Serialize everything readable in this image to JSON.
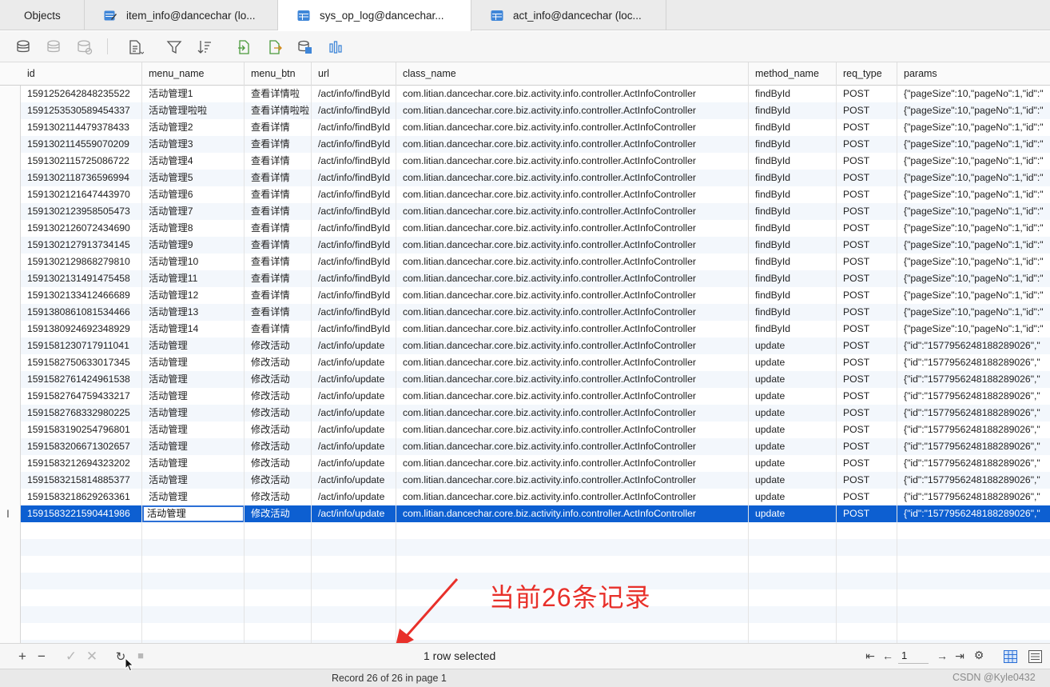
{
  "tabs": {
    "objects": "Objects",
    "t1": "item_info@dancechar (lo...",
    "t2": "sys_op_log@dancechar...",
    "t3": "act_info@dancechar (loc..."
  },
  "columns": [
    "id",
    "menu_name",
    "menu_btn",
    "url",
    "class_name",
    "method_name",
    "req_type",
    "params"
  ],
  "rows": [
    [
      "1591252642848235522",
      "活动管理1",
      "查看详情啦",
      "/act/info/findById",
      "com.litian.dancechar.core.biz.activity.info.controller.ActInfoController",
      "findById",
      "POST",
      "{\"pageSize\":10,\"pageNo\":1,\"id\":\""
    ],
    [
      "1591253530589454337",
      "活动管理啦啦",
      "查看详情啦啦",
      "/act/info/findById",
      "com.litian.dancechar.core.biz.activity.info.controller.ActInfoController",
      "findById",
      "POST",
      "{\"pageSize\":10,\"pageNo\":1,\"id\":\""
    ],
    [
      "1591302114479378433",
      "活动管理2",
      "查看详情",
      "/act/info/findById",
      "com.litian.dancechar.core.biz.activity.info.controller.ActInfoController",
      "findById",
      "POST",
      "{\"pageSize\":10,\"pageNo\":1,\"id\":\""
    ],
    [
      "1591302114559070209",
      "活动管理3",
      "查看详情",
      "/act/info/findById",
      "com.litian.dancechar.core.biz.activity.info.controller.ActInfoController",
      "findById",
      "POST",
      "{\"pageSize\":10,\"pageNo\":1,\"id\":\""
    ],
    [
      "1591302115725086722",
      "活动管理4",
      "查看详情",
      "/act/info/findById",
      "com.litian.dancechar.core.biz.activity.info.controller.ActInfoController",
      "findById",
      "POST",
      "{\"pageSize\":10,\"pageNo\":1,\"id\":\""
    ],
    [
      "1591302118736596994",
      "活动管理5",
      "查看详情",
      "/act/info/findById",
      "com.litian.dancechar.core.biz.activity.info.controller.ActInfoController",
      "findById",
      "POST",
      "{\"pageSize\":10,\"pageNo\":1,\"id\":\""
    ],
    [
      "1591302121647443970",
      "活动管理6",
      "查看详情",
      "/act/info/findById",
      "com.litian.dancechar.core.biz.activity.info.controller.ActInfoController",
      "findById",
      "POST",
      "{\"pageSize\":10,\"pageNo\":1,\"id\":\""
    ],
    [
      "1591302123958505473",
      "活动管理7",
      "查看详情",
      "/act/info/findById",
      "com.litian.dancechar.core.biz.activity.info.controller.ActInfoController",
      "findById",
      "POST",
      "{\"pageSize\":10,\"pageNo\":1,\"id\":\""
    ],
    [
      "1591302126072434690",
      "活动管理8",
      "查看详情",
      "/act/info/findById",
      "com.litian.dancechar.core.biz.activity.info.controller.ActInfoController",
      "findById",
      "POST",
      "{\"pageSize\":10,\"pageNo\":1,\"id\":\""
    ],
    [
      "1591302127913734145",
      "活动管理9",
      "查看详情",
      "/act/info/findById",
      "com.litian.dancechar.core.biz.activity.info.controller.ActInfoController",
      "findById",
      "POST",
      "{\"pageSize\":10,\"pageNo\":1,\"id\":\""
    ],
    [
      "1591302129868279810",
      "活动管理10",
      "查看详情",
      "/act/info/findById",
      "com.litian.dancechar.core.biz.activity.info.controller.ActInfoController",
      "findById",
      "POST",
      "{\"pageSize\":10,\"pageNo\":1,\"id\":\""
    ],
    [
      "1591302131491475458",
      "活动管理11",
      "查看详情",
      "/act/info/findById",
      "com.litian.dancechar.core.biz.activity.info.controller.ActInfoController",
      "findById",
      "POST",
      "{\"pageSize\":10,\"pageNo\":1,\"id\":\""
    ],
    [
      "1591302133412466689",
      "活动管理12",
      "查看详情",
      "/act/info/findById",
      "com.litian.dancechar.core.biz.activity.info.controller.ActInfoController",
      "findById",
      "POST",
      "{\"pageSize\":10,\"pageNo\":1,\"id\":\""
    ],
    [
      "1591380861081534466",
      "活动管理13",
      "查看详情",
      "/act/info/findById",
      "com.litian.dancechar.core.biz.activity.info.controller.ActInfoController",
      "findById",
      "POST",
      "{\"pageSize\":10,\"pageNo\":1,\"id\":\""
    ],
    [
      "1591380924692348929",
      "活动管理14",
      "查看详情",
      "/act/info/findById",
      "com.litian.dancechar.core.biz.activity.info.controller.ActInfoController",
      "findById",
      "POST",
      "{\"pageSize\":10,\"pageNo\":1,\"id\":\""
    ],
    [
      "1591581230717911041",
      "活动管理",
      "修改活动",
      "/act/info/update",
      "com.litian.dancechar.core.biz.activity.info.controller.ActInfoController",
      "update",
      "POST",
      "{\"id\":\"1577956248188289026\",\""
    ],
    [
      "1591582750633017345",
      "活动管理",
      "修改活动",
      "/act/info/update",
      "com.litian.dancechar.core.biz.activity.info.controller.ActInfoController",
      "update",
      "POST",
      "{\"id\":\"1577956248188289026\",\""
    ],
    [
      "1591582761424961538",
      "活动管理",
      "修改活动",
      "/act/info/update",
      "com.litian.dancechar.core.biz.activity.info.controller.ActInfoController",
      "update",
      "POST",
      "{\"id\":\"1577956248188289026\",\""
    ],
    [
      "1591582764759433217",
      "活动管理",
      "修改活动",
      "/act/info/update",
      "com.litian.dancechar.core.biz.activity.info.controller.ActInfoController",
      "update",
      "POST",
      "{\"id\":\"1577956248188289026\",\""
    ],
    [
      "1591582768332980225",
      "活动管理",
      "修改活动",
      "/act/info/update",
      "com.litian.dancechar.core.biz.activity.info.controller.ActInfoController",
      "update",
      "POST",
      "{\"id\":\"1577956248188289026\",\""
    ],
    [
      "1591583190254796801",
      "活动管理",
      "修改活动",
      "/act/info/update",
      "com.litian.dancechar.core.biz.activity.info.controller.ActInfoController",
      "update",
      "POST",
      "{\"id\":\"1577956248188289026\",\""
    ],
    [
      "1591583206671302657",
      "活动管理",
      "修改活动",
      "/act/info/update",
      "com.litian.dancechar.core.biz.activity.info.controller.ActInfoController",
      "update",
      "POST",
      "{\"id\":\"1577956248188289026\",\""
    ],
    [
      "1591583212694323202",
      "活动管理",
      "修改活动",
      "/act/info/update",
      "com.litian.dancechar.core.biz.activity.info.controller.ActInfoController",
      "update",
      "POST",
      "{\"id\":\"1577956248188289026\",\""
    ],
    [
      "1591583215814885377",
      "活动管理",
      "修改活动",
      "/act/info/update",
      "com.litian.dancechar.core.biz.activity.info.controller.ActInfoController",
      "update",
      "POST",
      "{\"id\":\"1577956248188289026\",\""
    ],
    [
      "1591583218629263361",
      "活动管理",
      "修改活动",
      "/act/info/update",
      "com.litian.dancechar.core.biz.activity.info.controller.ActInfoController",
      "update",
      "POST",
      "{\"id\":\"1577956248188289026\",\""
    ],
    [
      "1591583221590441986",
      "活动管理",
      "修改活动",
      "/act/info/update",
      "com.litian.dancechar.core.biz.activity.info.controller.ActInfoController",
      "update",
      "POST",
      "{\"id\":\"1577956248188289026\",\""
    ]
  ],
  "selected_row": 25,
  "status": {
    "selection": "1 row selected",
    "page_number": "1",
    "record_info": "Record 26 of 26 in page 1"
  },
  "annotation": "当前26条记录",
  "watermark": "CSDN @Kyle0432",
  "colors": {
    "selection": "#0d5fd1",
    "annotation": "#e8302a"
  }
}
